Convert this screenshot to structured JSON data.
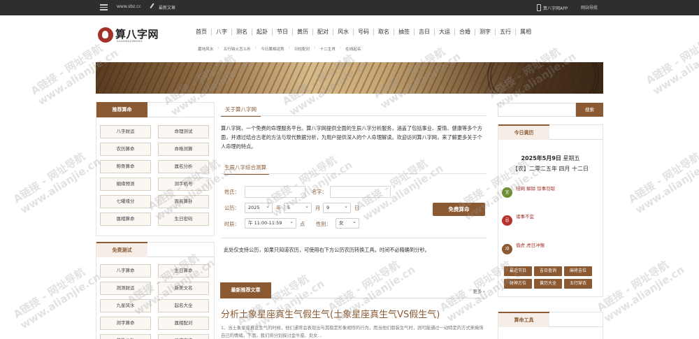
{
  "topbar": {
    "site_url": "www.sbz.cc",
    "recent_label": "最新文章",
    "app_label": "算八字网APP",
    "nav_label": "网站导航"
  },
  "logo": {
    "title": "算八字网",
    "subtitle": "SUANBAZIWANG"
  },
  "main_nav": [
    "首页",
    "八字",
    "测名",
    "起卦",
    "节日",
    "黄历",
    "配对",
    "风水",
    "号码",
    "取名",
    "抽签",
    "吉日",
    "大运",
    "合婚",
    "测字",
    "五行",
    "属相"
  ],
  "sub_nav": [
    "墓地风水",
    "五行缺火怎么补",
    "今日属相运势",
    "日柱配对",
    "十二生肖",
    "在线起名"
  ],
  "left_panel": {
    "tab1": "推荐算命",
    "recommend": [
      "八字财运",
      "命理测试",
      "农历算命",
      "命格测算",
      "称骨算命",
      "属名分析",
      "姻缘预测",
      "测手机号",
      "七曜缘分",
      "周易算卦",
      "属相算命",
      "生日密码"
    ],
    "tab2": "免费测试",
    "free": [
      "八字算命",
      "生日算命",
      "测测财运",
      "新美文名",
      "九星风水",
      "起名大全",
      "测字算命",
      "属相配对",
      "紫微斗数",
      "星座查询"
    ]
  },
  "center": {
    "about_title": "关于算八字网",
    "about_text": "算八字网，一个免费的命理服务平台。算八字网提供全面的生辰八字分析服务，涵盖了包括事业、爱情、健康等多个方面，并通过结合古老的方法与现代数据分析，为用户提供深入的个人命理解读。欢迎访问算八字网，来了解更多关于个人命理的特点。",
    "form_title": "生辰八字综合测算",
    "form": {
      "lastname_label": "姓氏：",
      "firstname_label": "名字：",
      "birth_label": "公历：",
      "year": "2025",
      "year_unit": "年",
      "month": "5",
      "month_unit": "月",
      "day": "9",
      "day_unit": "日",
      "hour_label": "时辰：",
      "hour": "午 11:00-11:59",
      "hour_unit": "点",
      "gender_label": "性别：",
      "gender": "女",
      "submit": "免费算命"
    },
    "note": "此处仅支持公历，如果只知道农历，可使用右下方公历农历转换工具。时间不必精确到分秒。",
    "articles_tab": "最新推荐文章",
    "more": "更多",
    "article_title": "分析土象星座真生气假生气(土象星座真生气VS假生气)",
    "article_excerpt": "1、当土象星座真正生气的时候，他们通常会表现出与其稳定形象相悖的行为，而当他们假装生气时，则可能通过一动特定的方式来掩饰自己的情绪。下面，我们将分别探讨金牛座、处女..."
  },
  "right_panel": {
    "search_button": "搜索",
    "almanac_title": "今日黄历",
    "date_prefix": "2025年5月9日",
    "weekday": "星期五",
    "lunar": "【农】二零二五年 四月 十二日",
    "items": [
      {
        "badge": "宜",
        "text": "结网 解除 馀事勿取",
        "color": "#6a8e2a"
      },
      {
        "badge": "忌",
        "text": "诸事不宜",
        "color": "#b7322a"
      },
      {
        "badge": "冲",
        "text": "值虎 虎日冲猴",
        "color": "#8b5a33"
      }
    ],
    "tags": [
      "最近节日",
      "吉日查询",
      "麻将吉位",
      "财神方位",
      "黄历大全",
      "五行穿衣"
    ],
    "tools_title": "算命工具"
  },
  "watermark": {
    "line1": "A链接 - 网址导航",
    "line2": "www.alianjie.cn"
  }
}
